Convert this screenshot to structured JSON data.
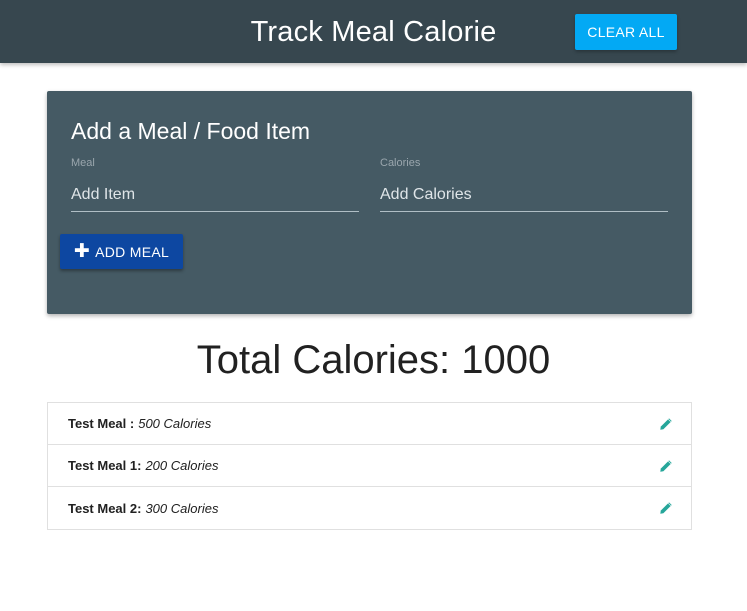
{
  "header": {
    "title": "Track Meal Calorie",
    "clear_all_label": "CLEAR ALL"
  },
  "form": {
    "title": "Add a Meal / Food Item",
    "meal_label": "Meal",
    "meal_placeholder": "Add Item",
    "calories_label": "Calories",
    "calories_placeholder": "Add Calories",
    "add_button_label": "ADD MEAL",
    "add_button_icon": "plus-icon"
  },
  "total": {
    "text": "Total Calories: 1000"
  },
  "meals": [
    {
      "name": "Test Meal :",
      "calories": "500 Calories",
      "icon": "pencil-icon"
    },
    {
      "name": "Test Meal 1:",
      "calories": "200 Calories",
      "icon": "pencil-icon"
    },
    {
      "name": "Test Meal 2:",
      "calories": "300 Calories",
      "icon": "pencil-icon"
    }
  ],
  "colors": {
    "navbar": "#37474f",
    "card": "#455a64",
    "clear_button": "#03a9f4",
    "add_button": "#0d47a1",
    "edit_icon": "#26a69a"
  }
}
